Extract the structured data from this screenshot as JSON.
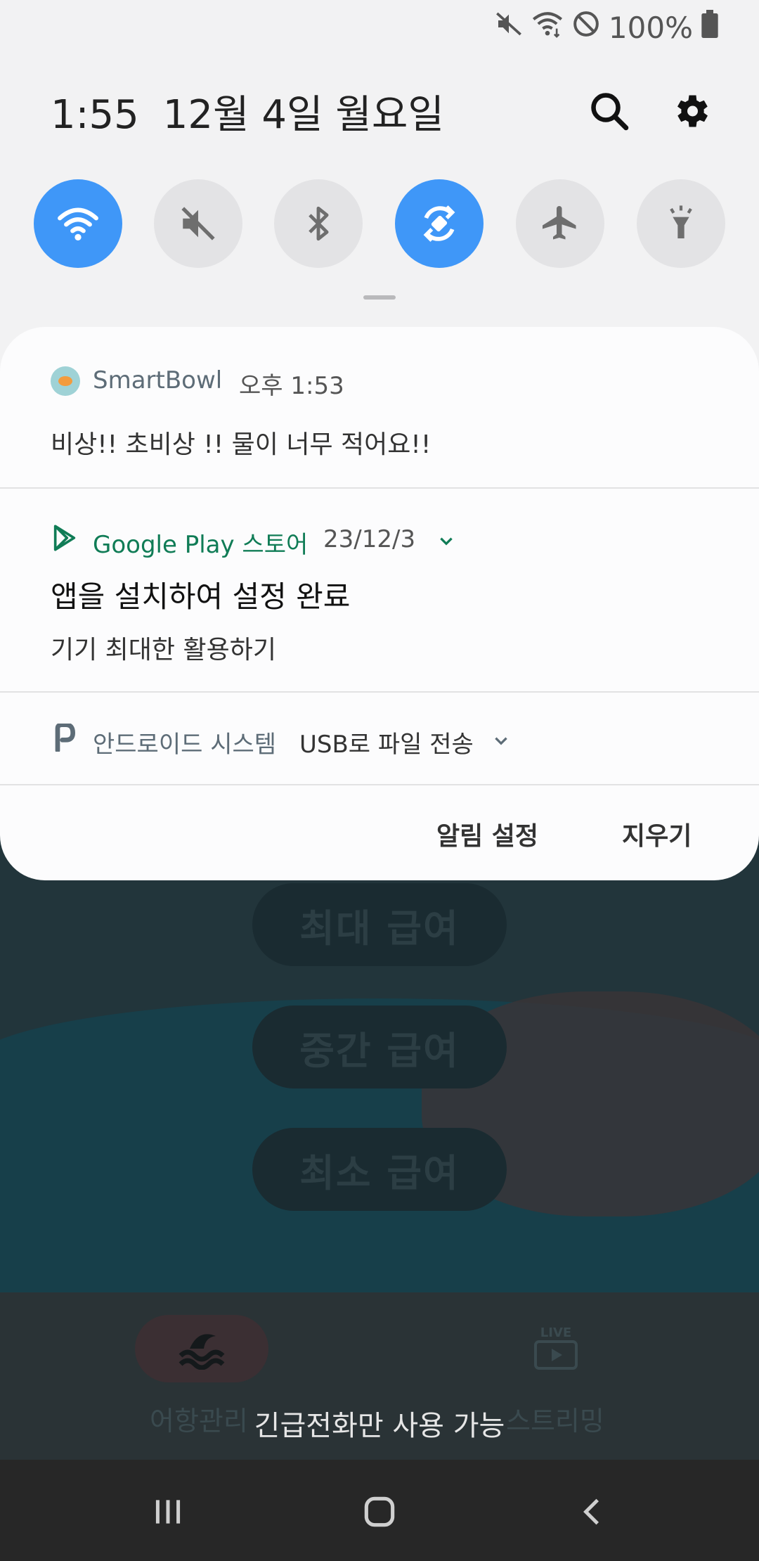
{
  "status_bar": {
    "battery_pct": "100%",
    "icons": [
      "mute-icon",
      "wifi-icon",
      "do-not-disturb-icon",
      "battery-icon"
    ]
  },
  "header": {
    "time": "1:55",
    "date": "12월 4일 월요일"
  },
  "quick_settings": [
    {
      "name": "wifi",
      "state": "on"
    },
    {
      "name": "sound",
      "state": "off"
    },
    {
      "name": "bluetooth",
      "state": "off"
    },
    {
      "name": "auto-rotate",
      "state": "on"
    },
    {
      "name": "airplane",
      "state": "off"
    },
    {
      "name": "flashlight",
      "state": "off"
    }
  ],
  "notifications": [
    {
      "app": "SmartBowl",
      "time": "오후 1:53",
      "text": "비상!! 초비상 !! 물이 너무 적어요!!"
    },
    {
      "app": "Google Play 스토어",
      "time": "23/12/3",
      "title": "앱을 설치하여 설정 완료",
      "text": "기기 최대한 활용하기"
    },
    {
      "app": "안드로이드 시스템",
      "text": "USB로 파일 전송"
    }
  ],
  "actions": {
    "settings": "알림 설정",
    "clear": "지우기"
  },
  "background_app": {
    "buttons": [
      "최대 급여",
      "중간 급여",
      "최소 급여"
    ],
    "nav": [
      "어항관리",
      "스트리밍"
    ],
    "live_label": "LIVE"
  },
  "toast": "긴급전화만 사용 가능",
  "colors": {
    "accent": "#3f97f8",
    "play_green": "#107c56",
    "panel": "#fcfcfd"
  }
}
